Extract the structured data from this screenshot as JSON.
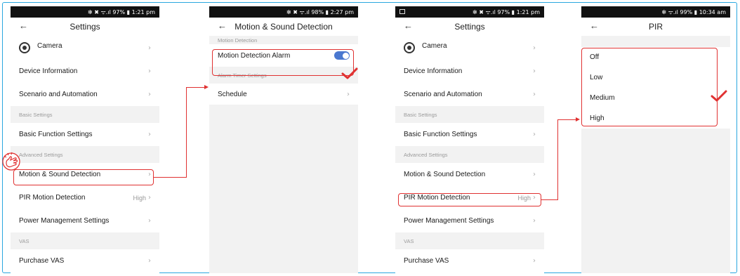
{
  "phone1": {
    "status": "✻ ✖ ᯤ.ıl 97% ▮ 1:21 pm",
    "title": "Settings",
    "camera": "Camera",
    "device_info": "Device Information",
    "scenario": "Scenario and Automation",
    "basic_section": "Basic Settings",
    "basic_function": "Basic Function Settings",
    "advanced_section": "Advanced Settings",
    "motion_sound": "Motion & Sound Detection",
    "pir_motion": "PIR Motion Detection",
    "pir_value": "High",
    "power_mgmt": "Power Management Settings",
    "vas_section": "VAS",
    "purchase_vas": "Purchase VAS"
  },
  "phone2": {
    "status": "✻ ✖ ᯤ.ıl 98% ▮ 2:27 pm",
    "title": "Motion & Sound Detection",
    "motion_section": "Motion Detection",
    "motion_alarm": "Motion Detection Alarm",
    "motion_alarm_on": true,
    "timer_section": "Alarm Timer Settings",
    "schedule": "Schedule"
  },
  "phone3": {
    "status": "✻ ✖ ᯤ.ıl 97% ▮ 1:21 pm",
    "title": "Settings",
    "camera": "Camera",
    "device_info": "Device Information",
    "scenario": "Scenario and Automation",
    "basic_section": "Basic Settings",
    "basic_function": "Basic Function Settings",
    "advanced_section": "Advanced Settings",
    "motion_sound": "Motion & Sound Detection",
    "pir_motion": "PIR Motion Detection",
    "pir_value": "High",
    "power_mgmt": "Power Management Settings",
    "vas_section": "VAS",
    "purchase_vas": "Purchase VAS"
  },
  "phone4": {
    "status": "✻ ᯤ.ıl 99% ▮ 10:34 am",
    "title": "PIR",
    "options": [
      "Off",
      "Low",
      "Medium",
      "High"
    ],
    "selected": "Medium"
  },
  "icons": {
    "back": "←",
    "chevron": "›"
  },
  "colors": {
    "highlight": "#e03131",
    "frame": "#2aa7df",
    "toggle": "#4a78d0"
  }
}
